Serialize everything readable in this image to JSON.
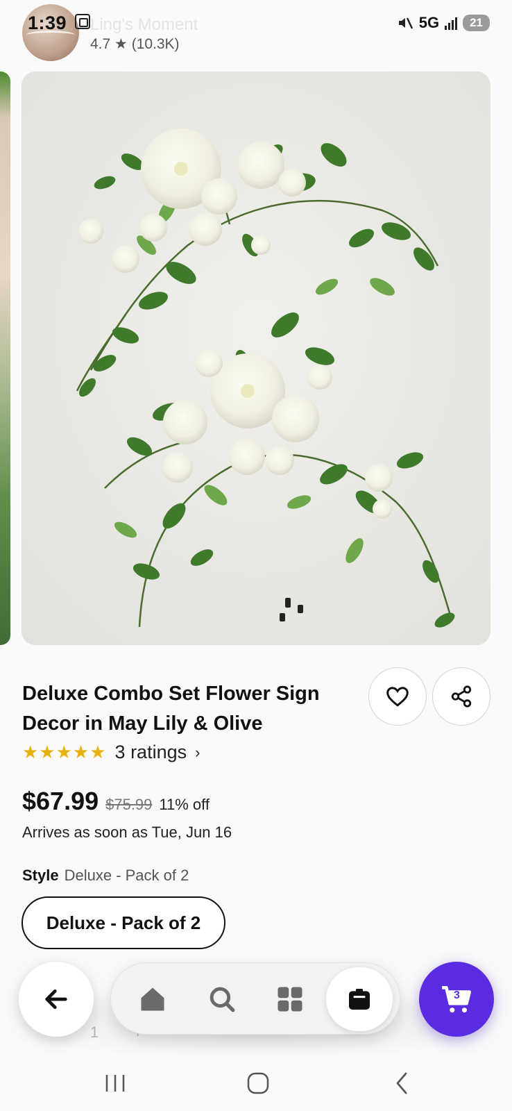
{
  "status_bar": {
    "time": "1:39",
    "network": "5G",
    "battery": "21"
  },
  "seller": {
    "name": "Ling's Moment",
    "rating": "4.7 ★ (10.3K)"
  },
  "product": {
    "title": "Deluxe Combo Set Flower Sign Decor in May Lily & Olive",
    "stars": "★★★★★",
    "rating_count": "3 ratings",
    "rating_value": 5,
    "price": "$67.99",
    "original_price": "$75.99",
    "discount": "11% off",
    "arrival": "Arrives as soon as Tue, Jun 16",
    "style_label": "Style",
    "style_value": "Deluxe - Pack of 2",
    "style_option": "Deluxe - Pack of 2"
  },
  "quantity": {
    "value": "1",
    "increment": "+"
  },
  "nav": {
    "cart_count": "3"
  },
  "colors": {
    "accent": "#5a2be0",
    "star": "#e7b10f"
  }
}
